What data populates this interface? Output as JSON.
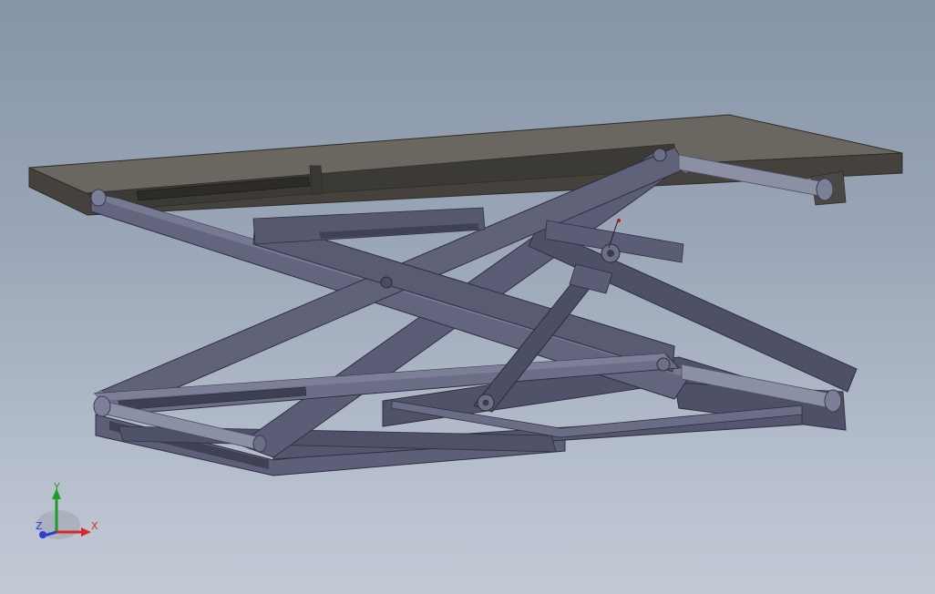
{
  "viewport": {
    "background_top": "#8795a8",
    "background_bottom": "#c3cad6"
  },
  "model": {
    "platform_color": "#45423d",
    "platform_top_color": "#6a6761",
    "frame_color": "#5b5d72",
    "frame_light": "#70738a",
    "frame_dark": "#3c3e50",
    "rod_color": "#8c90a4",
    "icons": [
      "platform",
      "scissor-arm",
      "hydraulic-cylinder",
      "base-frame",
      "roller-pin"
    ]
  },
  "triad": {
    "x_label": "X",
    "y_label": "Y",
    "z_label": "Z",
    "x_color": "#d42a2a",
    "y_color": "#1e9c2a",
    "z_color": "#2a3fd4"
  }
}
